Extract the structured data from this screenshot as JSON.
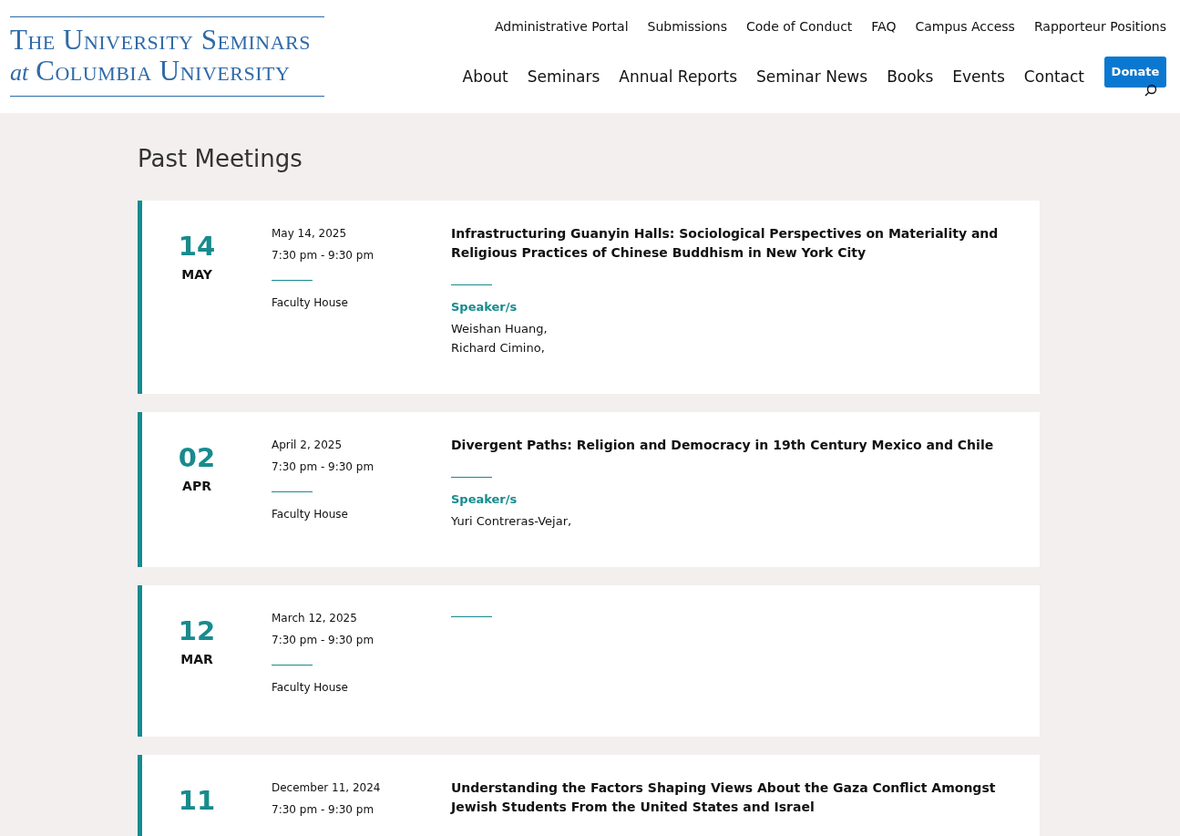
{
  "logo": {
    "line_1": "The University Seminars",
    "line_2_prefix": "at",
    "line_2": "Columbia University"
  },
  "top_links": [
    "Administrative Portal",
    "Submissions",
    "Code of Conduct",
    "FAQ",
    "Campus Access",
    "Rapporteur Positions"
  ],
  "main_nav": [
    "About",
    "Seminars",
    "Annual Reports",
    "Seminar News",
    "Books",
    "Events",
    "Contact"
  ],
  "donate_button": "Donate",
  "page_title": "Past Meetings",
  "meetings": [
    {
      "day": "14",
      "month": "MAY",
      "date": "May 14, 2025",
      "time": "7:30 pm - 9:30 pm",
      "location": "Faculty House",
      "title": "Infrastructuring Guanyin Halls: Sociological Perspectives on Materiality and Religious Practices of Chinese Buddhism in New York City",
      "speakers_label": "Speaker/s",
      "speakers": [
        "Weishan Huang,",
        "Richard Cimino,"
      ]
    },
    {
      "day": "02",
      "month": "APR",
      "date": "April 2, 2025",
      "time": "7:30 pm - 9:30 pm",
      "location": "Faculty House",
      "title": "Divergent Paths: Religion and Democracy in 19th Century Mexico and Chile",
      "speakers_label": "Speaker/s",
      "speakers": [
        "Yuri Contreras-Vejar,"
      ]
    },
    {
      "day": "12",
      "month": "MAR",
      "date": "March 12, 2025",
      "time": "7:30 pm - 9:30 pm",
      "location": "Faculty House"
    },
    {
      "day": "11",
      "date": "December 11, 2024",
      "time": "7:30 pm - 9:30 pm",
      "title": "Understanding the Factors Shaping Views About the Gaza Conflict Amongst Jewish Students From the United States and Israel"
    }
  ]
}
